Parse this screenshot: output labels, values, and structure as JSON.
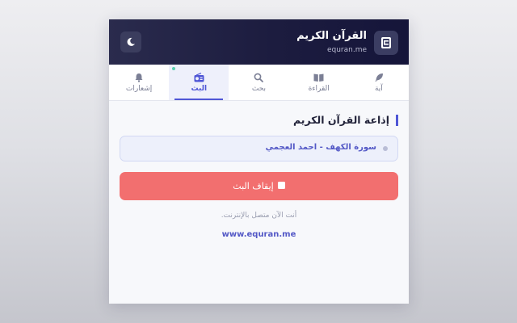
{
  "header": {
    "title": "القرآن الكريم",
    "domain": "equran.me",
    "app_icon": "book-icon",
    "theme_toggle_icon": "moon-icon"
  },
  "tabs": [
    {
      "label": "آية",
      "icon": "feather-icon",
      "active": false
    },
    {
      "label": "القراءة",
      "icon": "open-book-icon",
      "active": false
    },
    {
      "label": "بحث",
      "icon": "search-icon",
      "active": false
    },
    {
      "label": "البث",
      "icon": "radio-icon",
      "active": true
    },
    {
      "label": "إشعارات",
      "icon": "bell-icon",
      "active": false
    }
  ],
  "radio": {
    "section_title": "إذاعة القرآن الكريم",
    "now_playing": "سورة الكهف - احمد العجمي",
    "stop_label": "إيقاف البث",
    "status": "أنت الآن متصل بالإنترنت.",
    "site_link": "www.equran.me"
  },
  "colors": {
    "header_bg": "#1c1c3f",
    "accent": "#4f56d6",
    "stop_button": "#f26f6f",
    "now_playing_bg": "#edf0fb",
    "live_indicator": "#5ad0b0"
  }
}
